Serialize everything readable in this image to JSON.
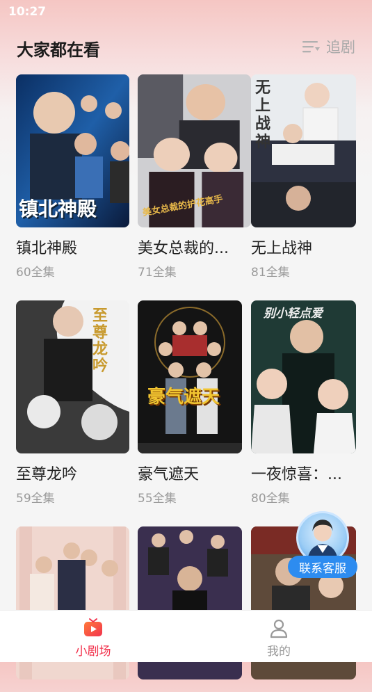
{
  "status_bar": {
    "time": "10:27"
  },
  "header": {
    "title": "大家都在看",
    "follow_label": "追剧",
    "follow_icon": "playlist-icon"
  },
  "dramas": [
    {
      "title": "镇北神殿",
      "count": "60全集",
      "poster_text": "镇北神殿"
    },
    {
      "title": "美女总裁的...",
      "count": "71全集",
      "poster_text": "美女总裁的护花高手"
    },
    {
      "title": "无上战神",
      "count": "81全集",
      "poster_text": "无上战神"
    },
    {
      "title": "至尊龙吟",
      "count": "59全集",
      "poster_text": "至尊龙吟"
    },
    {
      "title": "豪气遮天",
      "count": "55全集",
      "poster_text": "豪气遮天"
    },
    {
      "title": "一夜惊喜：...",
      "count": "80全集",
      "poster_text": "别小轻点爱"
    },
    {
      "title": "",
      "count": "",
      "poster_text": ""
    },
    {
      "title": "",
      "count": "",
      "poster_text": ""
    },
    {
      "title": "",
      "count": "",
      "poster_text": ""
    }
  ],
  "customer_service": {
    "label": "联系客服",
    "icon": "customer-service-agent-icon"
  },
  "tabbar": {
    "items": [
      {
        "label": "小剧场",
        "icon": "tv-icon",
        "active": true
      },
      {
        "label": "我的",
        "icon": "user-icon",
        "active": false
      }
    ]
  },
  "colors": {
    "accent": "#f2334d",
    "service_blue": "#2d8cf0"
  }
}
